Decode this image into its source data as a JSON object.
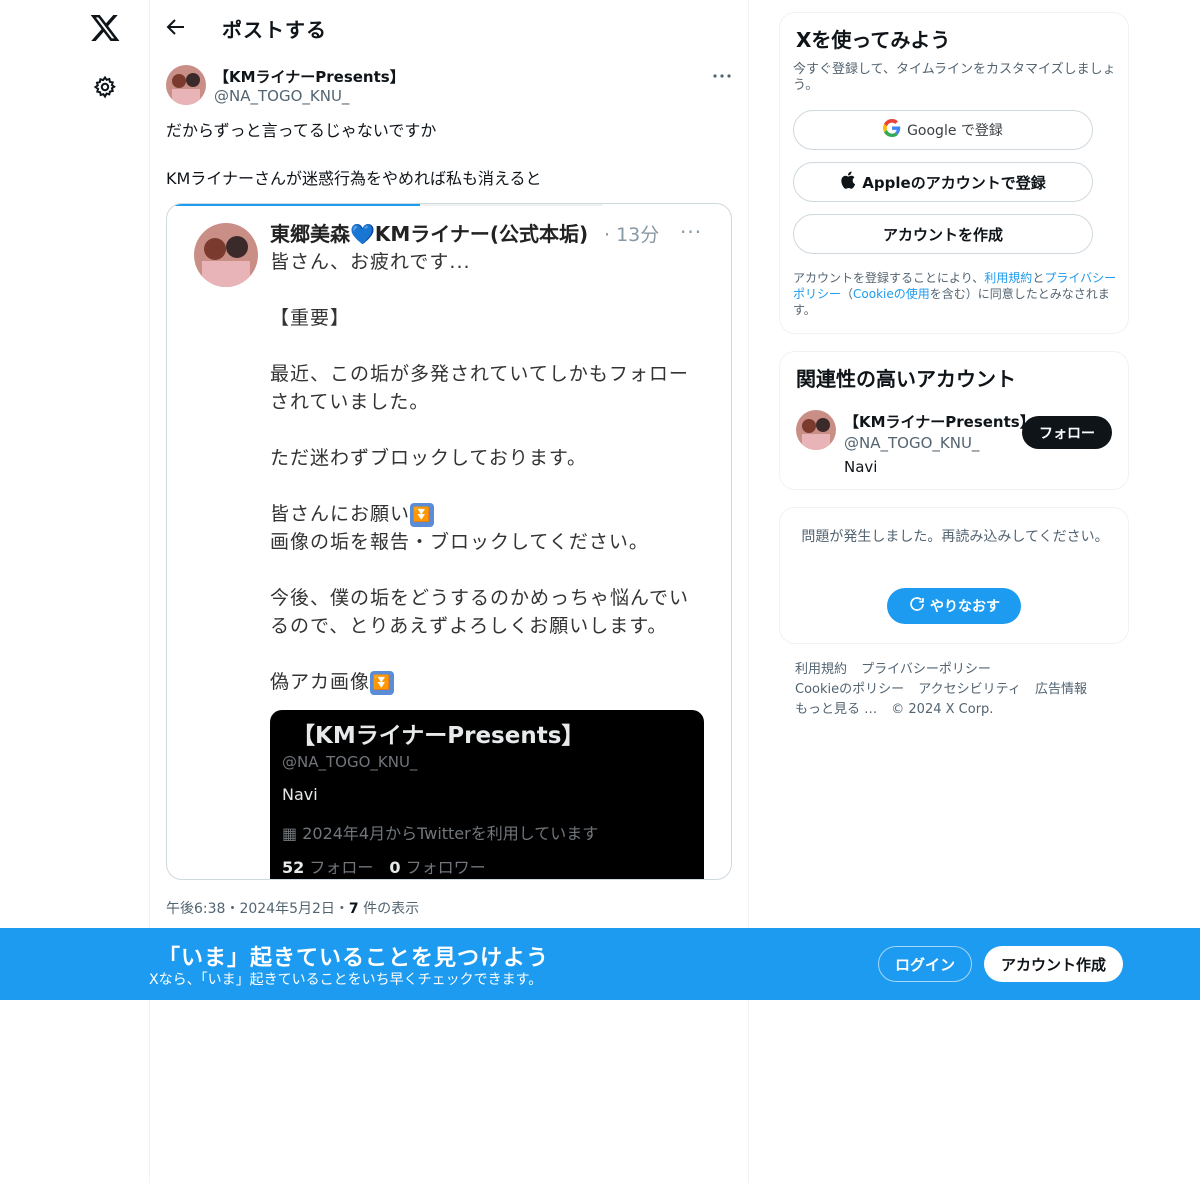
{
  "nav": {
    "logo_icon": "x-logo-icon",
    "settings_icon": "gear-icon"
  },
  "header": {
    "title": "ポストする",
    "back_icon": "arrow-left-icon"
  },
  "post": {
    "author_name": "【KMライナーPresents】",
    "author_handle": "@NA_TOGO_KNU_",
    "text": "だからずっと言ってるじゃないですか\n\nKMライナーさんが迷惑行為をやめれば私も消えると",
    "time": "午後6:38",
    "date": "2024年5月2日",
    "views_count": "7",
    "views_label": "件の表示",
    "separator": "・",
    "media_progress": 0.58
  },
  "embedded_screenshot": {
    "name": "東郷美森💙KMライナー(公式本垢)",
    "time": "· 13分",
    "more": "···",
    "body_intro": "皆さん、お疲れです...\n\n【重要】\n\n最近、この垢が多発されていてしかもフォロー\nされていました。\n\nただ迷わずブロックしております。\n\n皆さんにお願い",
    "body_mid": "画像の垢を報告・ブロックしてください。\n\n今後、僕の垢をどうするのかめっちゃ悩んでい\nるので、とりあえずよろしくお願いします。\n\n偽アカ画像",
    "emoji_glyph": "⏬",
    "dark_card": {
      "name": "【KMライナーPresents】",
      "handle": "@NA_TOGO_KNU_",
      "bio": "Navi",
      "joined": "2024年4月からTwitterを利用しています",
      "following_count": "52",
      "following_label": "フォロー",
      "followers_count": "0",
      "followers_label": "フォロワー"
    }
  },
  "signup": {
    "title": "Xを使ってみよう",
    "subtitle": "今すぐ登録して、タイムラインをカスタマイズしましょう。",
    "google_label": "Google で登録",
    "apple_label": "Appleのアカウントで登録",
    "create_label": "アカウントを作成",
    "terms_prefix": "アカウントを登録することにより、",
    "terms_link1": "利用規約",
    "terms_and": "と",
    "terms_link2": "プライバシーポリシー",
    "terms_mid": "（",
    "terms_link3": "Cookieの使用",
    "terms_suffix": "を含む）に同意したとみなされます。"
  },
  "related": {
    "title": "関連性の高いアカウント",
    "name": "【KMライナーPresents】",
    "handle": "@NA_TOGO_KNU_",
    "bio": "Navi",
    "follow_label": "フォロー"
  },
  "error": {
    "message": "問題が発生しました。再読み込みしてください。",
    "retry_label": "やりなおす"
  },
  "footer": {
    "links": [
      "利用規約",
      "プライバシーポリシー",
      "Cookieのポリシー",
      "アクセシビリティ",
      "広告情報",
      "もっと見る …"
    ],
    "copyright": "© 2024 X Corp."
  },
  "banner": {
    "title": "「いま」起きていることを見つけよう",
    "subtitle": "Xなら、「いま」起きていることをいち早くチェックできます。",
    "login_label": "ログイン",
    "signup_label": "アカウント作成"
  },
  "colors": {
    "accent": "#1d9bf0",
    "text": "#0f1419",
    "muted": "#536471"
  }
}
